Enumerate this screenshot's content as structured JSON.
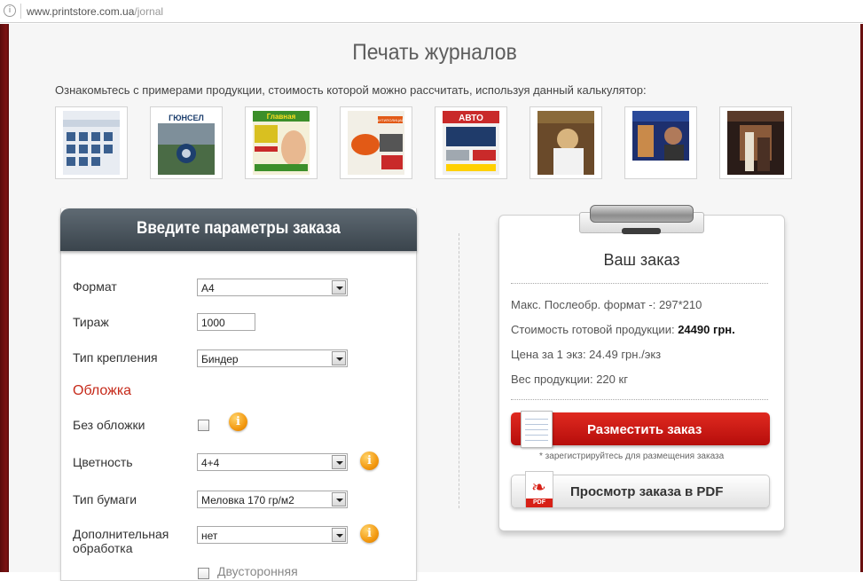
{
  "browser": {
    "url_host": "www.printstore.com.ua",
    "url_path": "/jornal"
  },
  "page": {
    "title": "Печать журналов",
    "intro": "Ознакомьтесь с примерами продукции, стоимость которой можно рассчитать, используя данный калькулятор:",
    "thumbnails": [
      {
        "title": "",
        "colors": [
          "#e8ecf2",
          "#3a5f8f"
        ]
      },
      {
        "title": "ГЮНСЕЛ",
        "colors": [
          "#1d3f6e",
          "#4a6b45"
        ]
      },
      {
        "title": "Главная",
        "colors": [
          "#3c8f2a",
          "#d9c020"
        ]
      },
      {
        "title": "АНТИПОЛИЦАЙ",
        "colors": [
          "#f2efe6",
          "#e25a16"
        ]
      },
      {
        "title": "АВТО",
        "colors": [
          "#1f3b6a",
          "#c92a2a"
        ]
      },
      {
        "title": "",
        "colors": [
          "#6a4a2a",
          "#d8b47e"
        ]
      },
      {
        "title": "",
        "colors": [
          "#1d2f6e",
          "#c98a4a"
        ]
      },
      {
        "title": "",
        "colors": [
          "#2a1c18",
          "#8a5a3a"
        ]
      }
    ]
  },
  "params": {
    "header": "Введите параметры заказа",
    "format": {
      "label": "Формат",
      "value": "А4"
    },
    "circulation": {
      "label": "Тираж",
      "value": "1000"
    },
    "binding": {
      "label": "Тип крепления",
      "value": "Биндер"
    },
    "cover_section": "Обложка",
    "no_cover": {
      "label": "Без обложки"
    },
    "color": {
      "label": "Цветность",
      "value": "4+4"
    },
    "paper": {
      "label": "Тип бумаги",
      "value": "Меловка 170 гр/м2"
    },
    "extra": {
      "label": "Дополнительная обработка",
      "value": "нет"
    },
    "duplex": {
      "label": "Двусторонняя"
    },
    "info_glyph": "i"
  },
  "order": {
    "title": "Ваш заказ",
    "format_label": "Макс. Послеобр. формат -: ",
    "format_value": "297*210",
    "cost_label": "Стоимость готовой продукции: ",
    "cost_value": "24490 грн.",
    "unit_label": "Цена за 1 экз: ",
    "unit_value": "24.49 грн./экз",
    "weight_label": "Вес продукции: ",
    "weight_value": "220 кг",
    "place_button": "Разместить заказ",
    "register_note": "* зарегистрируйтесь для размещения заказа",
    "pdf_button": "Просмотр заказа в PDF",
    "pdf_tag": "PDF"
  },
  "colors": {
    "accent": "#c62a1a",
    "header_dark": "#3a444c",
    "button_red": "#c8150f",
    "info_orange": "#f39a12"
  }
}
